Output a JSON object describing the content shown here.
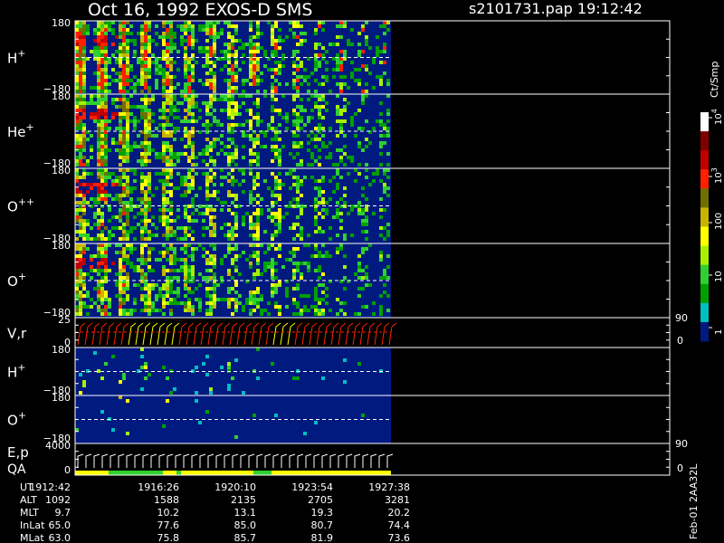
{
  "header": {
    "date_instrument": "Oct 16, 1992    EXOS-D SMS",
    "file_time": "s2101731.pap   19:12:42"
  },
  "chart_data": {
    "type": "heatmap",
    "description_panels": [
      {
        "key": "h_plus",
        "label": "H",
        "sup": "+",
        "ticks": [
          "180",
          "−180"
        ]
      },
      {
        "key": "he_plus",
        "label": "He",
        "sup": "+",
        "ticks": [
          "180",
          "−180"
        ]
      },
      {
        "key": "o_pp",
        "label": "O",
        "sup": "++",
        "ticks": [
          "180",
          "−180"
        ]
      },
      {
        "key": "o_plus",
        "label": "O",
        "sup": "+",
        "ticks": [
          "180",
          "−180"
        ]
      },
      {
        "key": "vr",
        "label": "V,r",
        "sup": "",
        "ticks": [
          "25",
          "0"
        ],
        "right_ticks": [
          "90",
          "0"
        ]
      },
      {
        "key": "h_plus_2",
        "label": "H",
        "sup": "+",
        "ticks": [
          "180",
          "−180"
        ]
      },
      {
        "key": "o_plus_2",
        "label": "O",
        "sup": "+",
        "ticks": [
          "180",
          "−180"
        ]
      },
      {
        "key": "ep",
        "label": "E,p",
        "sup": "",
        "label2": "QA",
        "ticks": [
          "4000",
          "0"
        ],
        "right_ticks": [
          "90",
          "0"
        ]
      }
    ],
    "colorbar": {
      "unit": "Ct/Smp",
      "tick_labels": [
        "10",
        "10",
        "100",
        "10",
        "1"
      ],
      "tick_sups": [
        "4",
        "3",
        "",
        "",
        ""
      ],
      "range": [
        1,
        10000
      ],
      "scale": "log",
      "colors": [
        "#001a80",
        "#00bfbf",
        "#00a000",
        "#30d030",
        "#a8f000",
        "#ffff00",
        "#c8b400",
        "#707000",
        "#ff2000",
        "#c00000",
        "#800000",
        "#ffffff"
      ]
    },
    "time_axis": {
      "rows": [
        {
          "name": "UT",
          "values": [
            "1912:42",
            "1916:26",
            "1920:10",
            "1923:54",
            "1927:38"
          ]
        },
        {
          "name": "ALT",
          "values": [
            "1092",
            "1588",
            "2135",
            "2705",
            "3281"
          ]
        },
        {
          "name": "MLT",
          "values": [
            "9.7",
            "10.2",
            "13.1",
            "19.3",
            "20.2"
          ]
        },
        {
          "name": "InLat",
          "values": [
            "65.0",
            "77.6",
            "85.0",
            "80.7",
            "74.4"
          ]
        },
        {
          "name": "MLat",
          "values": [
            "63.0",
            "75.8",
            "85.7",
            "81.9",
            "73.6"
          ]
        }
      ]
    },
    "footer_vertical": "Feb-01 2AA32L"
  }
}
